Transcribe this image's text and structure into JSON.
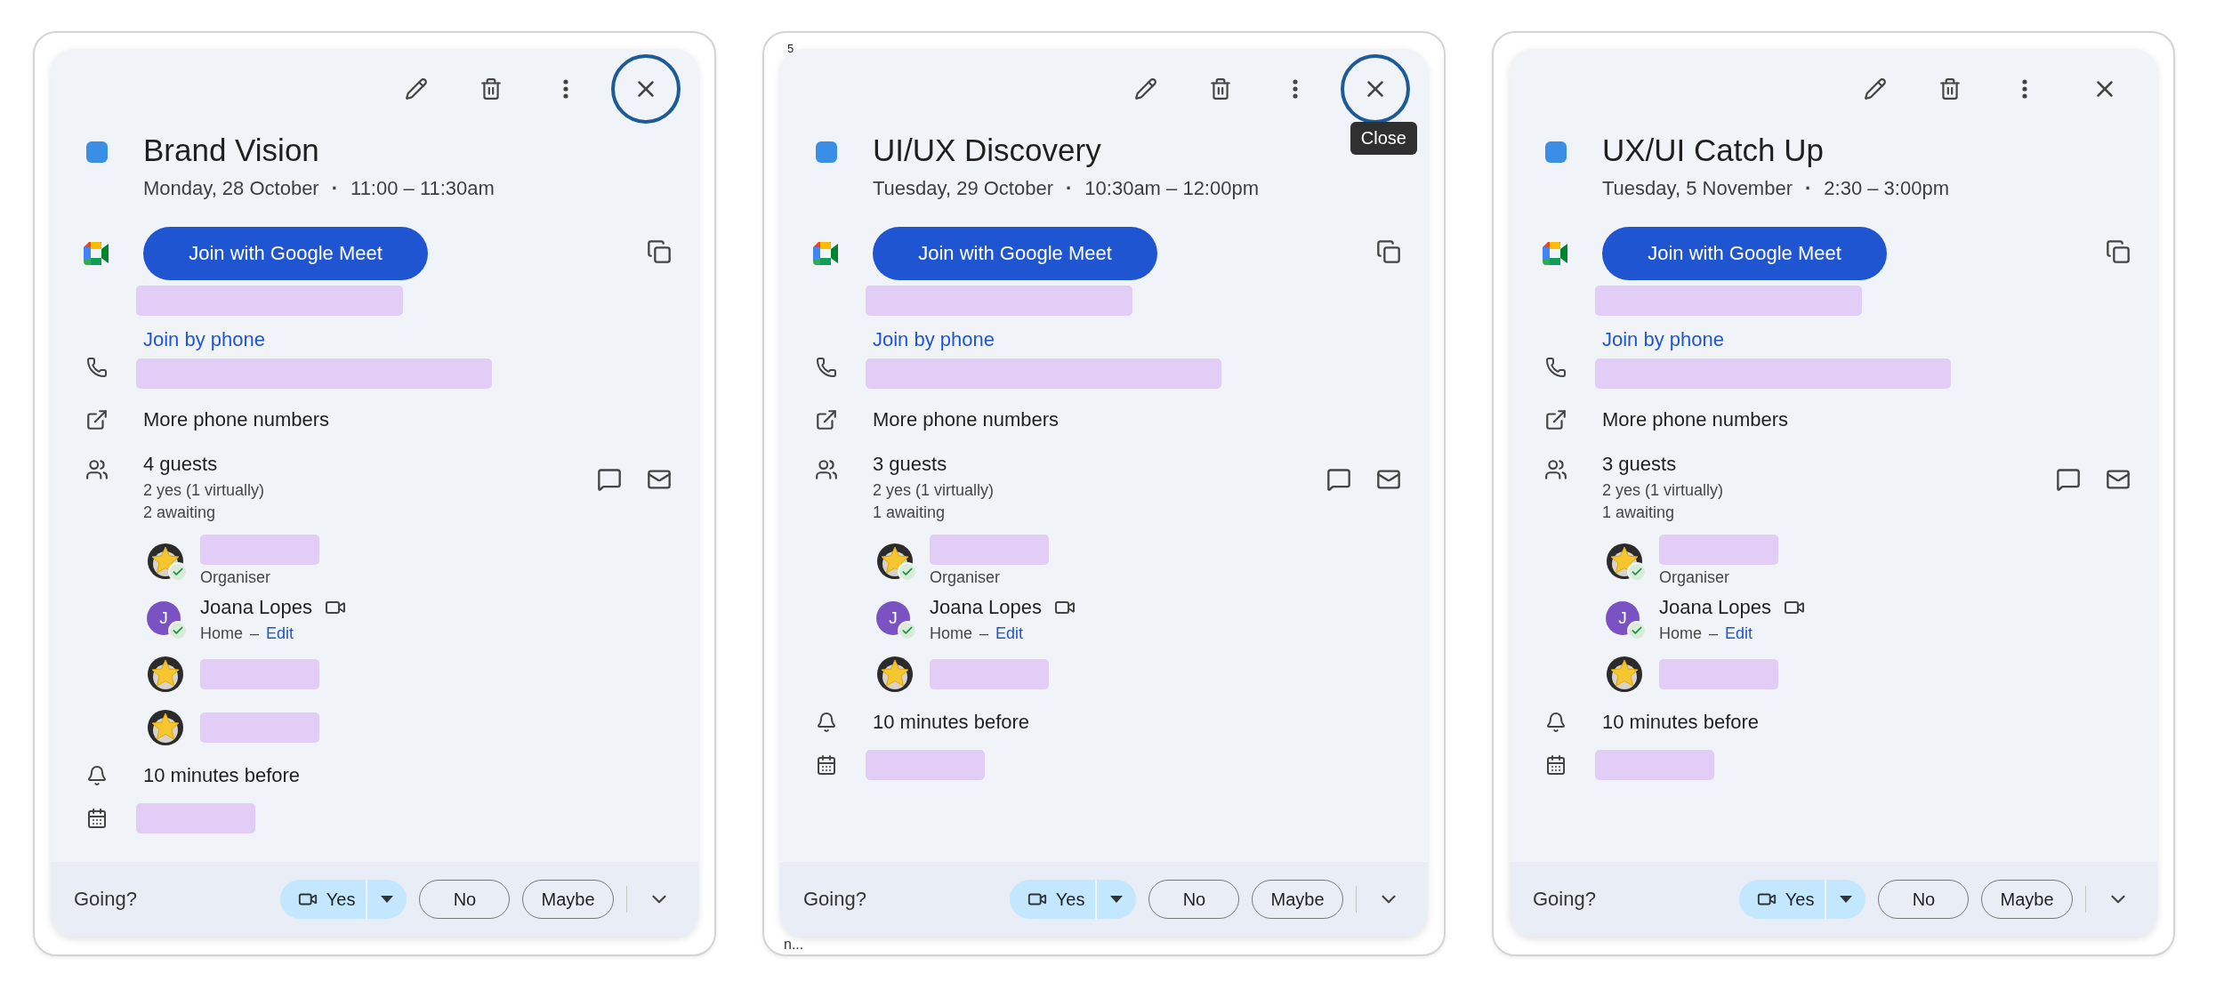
{
  "cards": [
    {
      "close_highlighted": true,
      "color": "#3a8ee6",
      "title": "Brand Vision",
      "date": "Monday, 28 October",
      "separator": "·",
      "time": "11:00 – 11:30am",
      "meet_button": "Join with Google Meet",
      "meet_code_hidden": true,
      "phone_link": "Join by phone",
      "phone_hidden": true,
      "more_numbers": "More phone numbers",
      "guest_count": "4 guests",
      "guest_yes": "2 yes (1 virtually)",
      "guest_awaiting": "2 awaiting",
      "guests": [
        {
          "kind": "star",
          "accepted": true,
          "name_hidden": true,
          "role": "Organiser"
        },
        {
          "kind": "initial",
          "initial": "J",
          "accepted": true,
          "name": "Joana Lopes",
          "video": true,
          "location": "Home",
          "location_separator": "–",
          "edit": "Edit"
        },
        {
          "kind": "star",
          "accepted": false,
          "name_hidden": true
        },
        {
          "kind": "star",
          "accepted": false,
          "name_hidden": true
        }
      ],
      "reminder": "10 minutes before",
      "calendar_hidden": true,
      "going_label": "Going?",
      "rsvp": [
        {
          "label": "Yes",
          "selected": true
        },
        {
          "label": "No",
          "selected": false
        },
        {
          "label": "Maybe",
          "selected": false
        }
      ]
    },
    {
      "corner_label": "5",
      "bottom_fragment": "n...",
      "close_highlighted": true,
      "tooltip": "Close",
      "color": "#3a8ee6",
      "title": "UI/UX Discovery",
      "date": "Tuesday, 29 October",
      "separator": "·",
      "time": "10:30am – 12:00pm",
      "meet_button": "Join with Google Meet",
      "meet_code_hidden": true,
      "phone_link": "Join by phone",
      "phone_hidden": true,
      "more_numbers": "More phone numbers",
      "guest_count": "3 guests",
      "guest_yes": "2 yes (1 virtually)",
      "guest_awaiting": "1 awaiting",
      "guests": [
        {
          "kind": "star",
          "accepted": true,
          "name_hidden": true,
          "role": "Organiser"
        },
        {
          "kind": "initial",
          "initial": "J",
          "accepted": true,
          "name": "Joana Lopes",
          "video": true,
          "location": "Home",
          "location_separator": "–",
          "edit": "Edit"
        },
        {
          "kind": "star",
          "accepted": false,
          "name_hidden": true
        }
      ],
      "reminder": "10 minutes before",
      "calendar_hidden": true,
      "going_label": "Going?",
      "rsvp": [
        {
          "label": "Yes",
          "selected": true
        },
        {
          "label": "No",
          "selected": false
        },
        {
          "label": "Maybe",
          "selected": false
        }
      ]
    },
    {
      "close_highlighted": false,
      "color": "#3a8ee6",
      "title": "UX/UI Catch Up",
      "date": "Tuesday, 5 November",
      "separator": "·",
      "time": "2:30 – 3:00pm",
      "meet_button": "Join with Google Meet",
      "meet_code_hidden": true,
      "phone_link": "Join by phone",
      "phone_hidden": true,
      "more_numbers": "More phone numbers",
      "guest_count": "3 guests",
      "guest_yes": "2 yes (1 virtually)",
      "guest_awaiting": "1 awaiting",
      "guests": [
        {
          "kind": "star",
          "accepted": true,
          "name_hidden": true,
          "role": "Organiser"
        },
        {
          "kind": "initial",
          "initial": "J",
          "accepted": true,
          "name": "Joana Lopes",
          "video": true,
          "location": "Home",
          "location_separator": "–",
          "edit": "Edit"
        },
        {
          "kind": "star",
          "accepted": false,
          "name_hidden": true
        }
      ],
      "reminder": "10 minutes before",
      "calendar_hidden": true,
      "going_label": "Going?",
      "rsvp": [
        {
          "label": "Yes",
          "selected": true
        },
        {
          "label": "No",
          "selected": false
        },
        {
          "label": "Maybe",
          "selected": false
        }
      ]
    }
  ]
}
